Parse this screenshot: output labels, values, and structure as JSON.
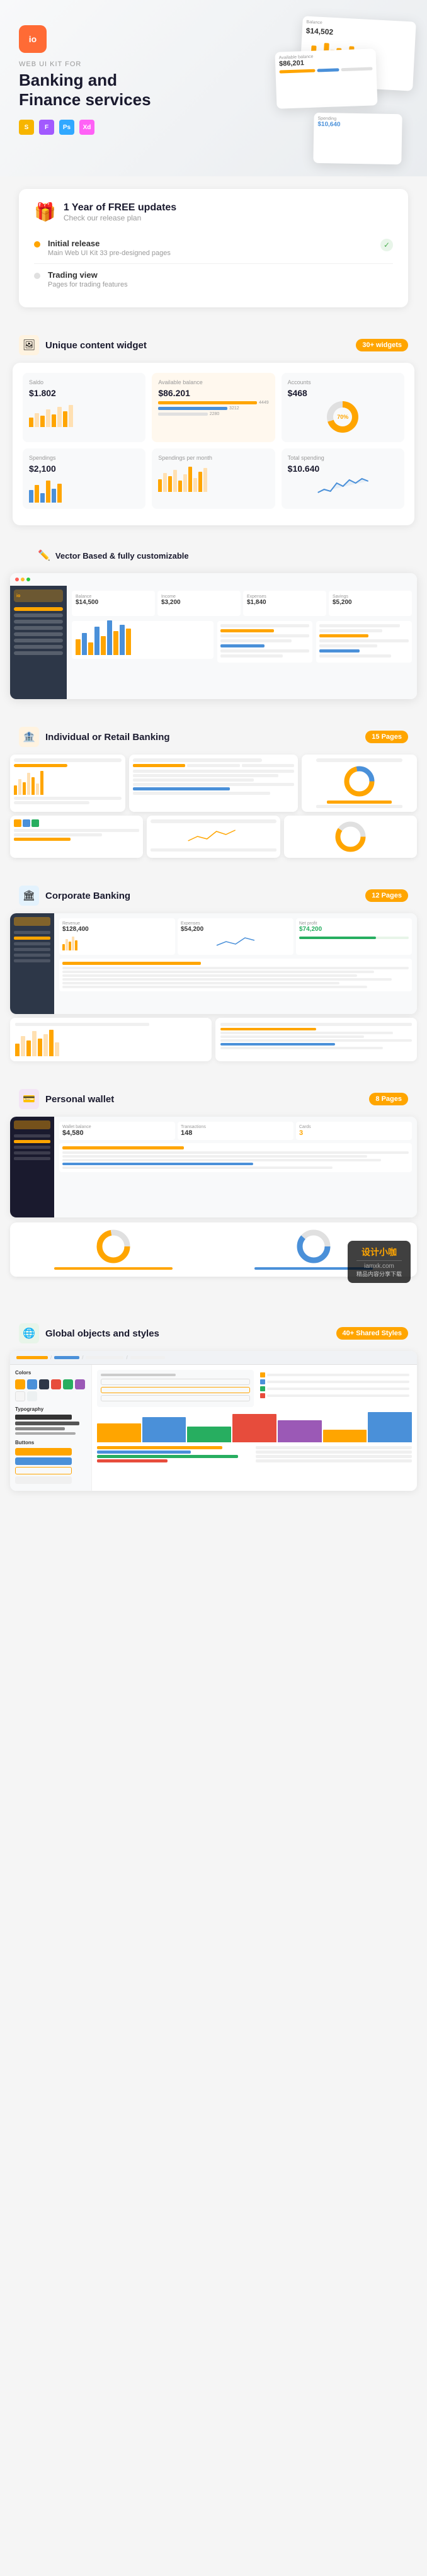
{
  "brand": {
    "logo_text": "io",
    "tagline": "WEB UI KIT FOR",
    "title": "Banking and\nFinance services",
    "tools": [
      "Sketch",
      "Figma",
      "Photoshop",
      "XD"
    ]
  },
  "update_banner": {
    "icon": "🎁",
    "title": "1 Year of FREE updates",
    "subtitle": "Check our release plan",
    "releases": [
      {
        "label": "Initial release",
        "desc": "Main Web UI Kit 33 pre-designed pages",
        "status": "done"
      },
      {
        "label": "Trading view",
        "desc": "Pages for trading features",
        "status": "pending"
      }
    ]
  },
  "sections": {
    "widgets": {
      "icon": "🖼",
      "title": "Unique content widget",
      "badge": "30+ widgets"
    },
    "vector": {
      "icon": "✏️",
      "title": "Vector Based & fully customizable"
    },
    "individual": {
      "icon": "🏦",
      "title": "Individual or Retail Banking",
      "badge": "15 Pages"
    },
    "corporate": {
      "icon": "🏛",
      "title": "Corporate Banking",
      "badge": "12 Pages"
    },
    "wallet": {
      "icon": "💳",
      "title": "Personal wallet",
      "badge": "8 Pages"
    },
    "global": {
      "icon": "🌐",
      "title": "Global objects and styles",
      "badge": "40+ Shared Styles"
    }
  },
  "widget_cards": [
    {
      "title": "Saldo",
      "value": "$1.802"
    },
    {
      "title": "Available balance",
      "value": "$86.201"
    },
    {
      "title": "Accounts",
      "value": "$468"
    }
  ],
  "dashboard_stats": [
    {
      "label": "Balance",
      "value": "$14,500"
    },
    {
      "label": "Income",
      "value": "$3,200"
    },
    {
      "label": "Expenses",
      "value": "$1,840"
    }
  ],
  "chart_bars": [
    3,
    5,
    4,
    7,
    6,
    8,
    5,
    9,
    7,
    6,
    8,
    5
  ],
  "colors": {
    "orange": "#ffa500",
    "blue": "#4a90d9",
    "dark": "#1a1a2e",
    "light_bg": "#f8f9fa"
  },
  "style_colors": [
    "#ffa500",
    "#4a90d9",
    "#2d3748",
    "#e74c3c",
    "#27ae60",
    "#9b59b6"
  ],
  "watermark": {
    "brand": "设计小咖",
    "domain": "iamxk.com",
    "tagline": "精品内容分享下载"
  }
}
